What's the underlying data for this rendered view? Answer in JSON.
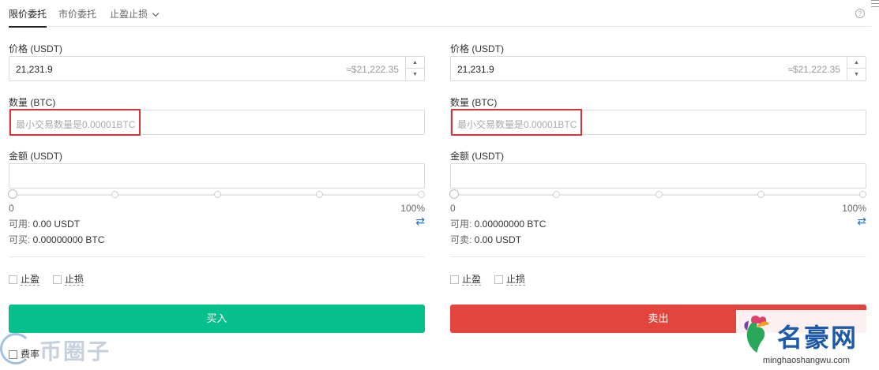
{
  "tabs": {
    "limit": "限价委托",
    "market": "市价委托",
    "stop": "止盈止损",
    "help": "?"
  },
  "buy": {
    "price_label": "价格 (USDT)",
    "price_value": "21,231.9",
    "price_approx": "≈$21,222.35",
    "qty_label": "数量 (BTC)",
    "qty_placeholder": "最小交易数量是0.00001BTC",
    "amount_label": "金额 (USDT)",
    "slider_min": "0",
    "slider_max": "100%",
    "slider_level": 0,
    "available_key": "可用:",
    "available_value": " 0.00 USDT",
    "can_key": "可买:",
    "can_value": " 0.00000000 BTC",
    "take_profit": "止盈",
    "stop_loss": "止损",
    "button": "买入"
  },
  "sell": {
    "price_label": "价格 (USDT)",
    "price_value": "21,231.9",
    "price_approx": "≈$21,222.35",
    "qty_label": "数量 (BTC)",
    "qty_placeholder": "最小交易数量是0.00001BTC",
    "amount_label": "金额 (USDT)",
    "slider_min": "0",
    "slider_max": "100%",
    "slider_level": 0,
    "available_key": "可用:",
    "available_value": " 0.00000000 BTC",
    "can_key": "可卖:",
    "can_value": " 0.00 USDT",
    "take_profit": "止盈",
    "stop_loss": "止损",
    "button": "卖出"
  },
  "fee": "费率",
  "watermark_left": "币圈子",
  "watermark_right_name": "名豪网",
  "watermark_right_url": "minghaoshangwu.com",
  "colors": {
    "buy": "#05c08a",
    "sell": "#e2453d",
    "highlight": "#d9333b",
    "swap": "#2b6fc9"
  }
}
